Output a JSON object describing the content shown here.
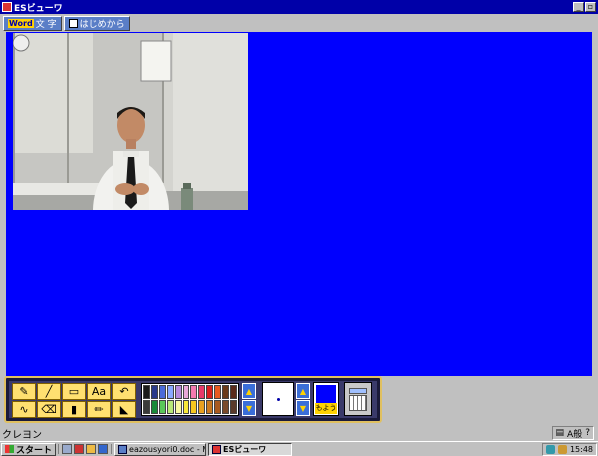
{
  "window": {
    "title": "ESビューワ",
    "minimize_icon": "minimize-icon",
    "restore_icon": "restore-icon",
    "restore_glyph": "▫"
  },
  "menubar": {
    "word_tag": "Word",
    "word_label": "文 字",
    "restart_label": "はじめから"
  },
  "canvas": {
    "background": "#0000fe"
  },
  "tools": [
    {
      "name": "crayon-tool",
      "icon": "✎"
    },
    {
      "name": "line-tool",
      "icon": "╱"
    },
    {
      "name": "rectangle-tool",
      "icon": "▭"
    },
    {
      "name": "text-tool",
      "icon": "Aa"
    },
    {
      "name": "undo-tool",
      "icon": "↶"
    },
    {
      "name": "freehand-tool",
      "icon": "∿"
    },
    {
      "name": "eraser-tool",
      "icon": "⌫"
    },
    {
      "name": "fill-tool",
      "icon": "▮"
    },
    {
      "name": "pencil-tool",
      "icon": "✏"
    },
    {
      "name": "stamp-tool",
      "icon": "◣"
    }
  ],
  "palette_colors": [
    "#1a1a1a",
    "#2a3a8a",
    "#4a6ad8",
    "#8aa8ff",
    "#b88adc",
    "#e8a8d8",
    "#f47ab0",
    "#e83a6a",
    "#d82020",
    "#e85a20",
    "#6a3a1a",
    "#5a2a1a",
    "#3a3a3a",
    "#1a8a3a",
    "#5ac85a",
    "#b8e878",
    "#f8f8a0",
    "#f8e838",
    "#f8c820",
    "#e8a020",
    "#c87820",
    "#a85a20",
    "#7a4a2a",
    "#5a3a2a"
  ],
  "current_color": {
    "color": "#0000fe",
    "pattern_label": "もよう"
  },
  "statusbar": {
    "mode_label": "クレヨン",
    "ime_label": "A般"
  },
  "taskbar": {
    "start_label": "スタート",
    "tasks": [
      {
        "label": "eazousyori0.doc - Micros...",
        "active": false
      },
      {
        "label": "ESビューワ",
        "active": true
      }
    ],
    "clock": "15:48"
  }
}
